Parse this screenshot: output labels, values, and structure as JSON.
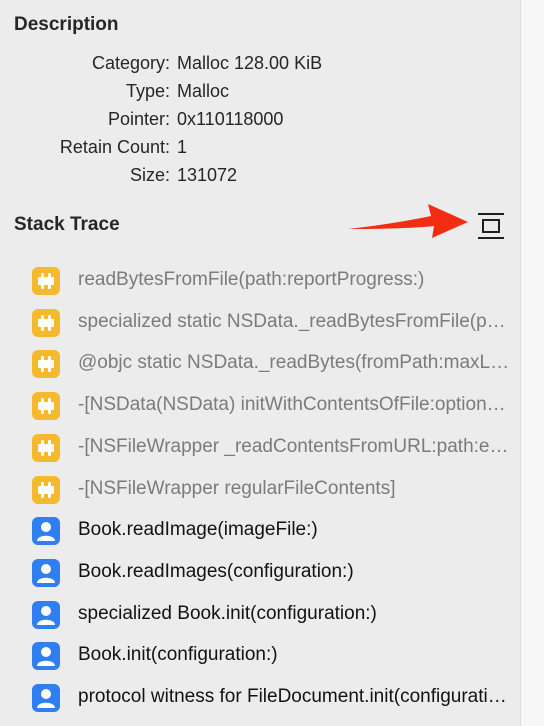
{
  "description": {
    "title": "Description",
    "rows": [
      {
        "key": "Category:",
        "value": "Malloc 128.00 KiB"
      },
      {
        "key": "Type:",
        "value": "Malloc"
      },
      {
        "key": "Pointer:",
        "value": "0x110118000"
      },
      {
        "key": "Retain Count:",
        "value": "1"
      },
      {
        "key": "Size:",
        "value": "131072"
      }
    ]
  },
  "stack_trace": {
    "title": "Stack Trace",
    "toggle_icon": "expand-collapse-icon",
    "annotation_arrow_color": "#f22d14",
    "frames": [
      {
        "kind": "library",
        "icon": "puzzle-icon",
        "label": "readBytesFromFile(path:reportProgress:)"
      },
      {
        "kind": "library",
        "icon": "puzzle-icon",
        "label": "specialized static NSData._readBytesFromFile(path:maxLength:)"
      },
      {
        "kind": "library",
        "icon": "puzzle-icon",
        "label": "@objc static NSData._readBytes(fromPath:maxLength:)"
      },
      {
        "kind": "library",
        "icon": "puzzle-icon",
        "label": "-[NSData(NSData) initWithContentsOfFile:options:error:]"
      },
      {
        "kind": "library",
        "icon": "puzzle-icon",
        "label": "-[NSFileWrapper _readContentsFromURL:path:error:]"
      },
      {
        "kind": "library",
        "icon": "puzzle-icon",
        "label": "-[NSFileWrapper regularFileContents]"
      },
      {
        "kind": "user",
        "icon": "user-icon",
        "label": "Book.readImage(imageFile:)"
      },
      {
        "kind": "user",
        "icon": "user-icon",
        "label": "Book.readImages(configuration:)"
      },
      {
        "kind": "user",
        "icon": "user-icon",
        "label": "specialized Book.init(configuration:)"
      },
      {
        "kind": "user",
        "icon": "user-icon",
        "label": "Book.init(configuration:)"
      },
      {
        "kind": "user",
        "icon": "user-icon",
        "label": "protocol witness for FileDocument.init(configuration:)"
      }
    ]
  },
  "colors": {
    "library_icon": "#f5b92e",
    "user_icon": "#2f7ff0"
  }
}
